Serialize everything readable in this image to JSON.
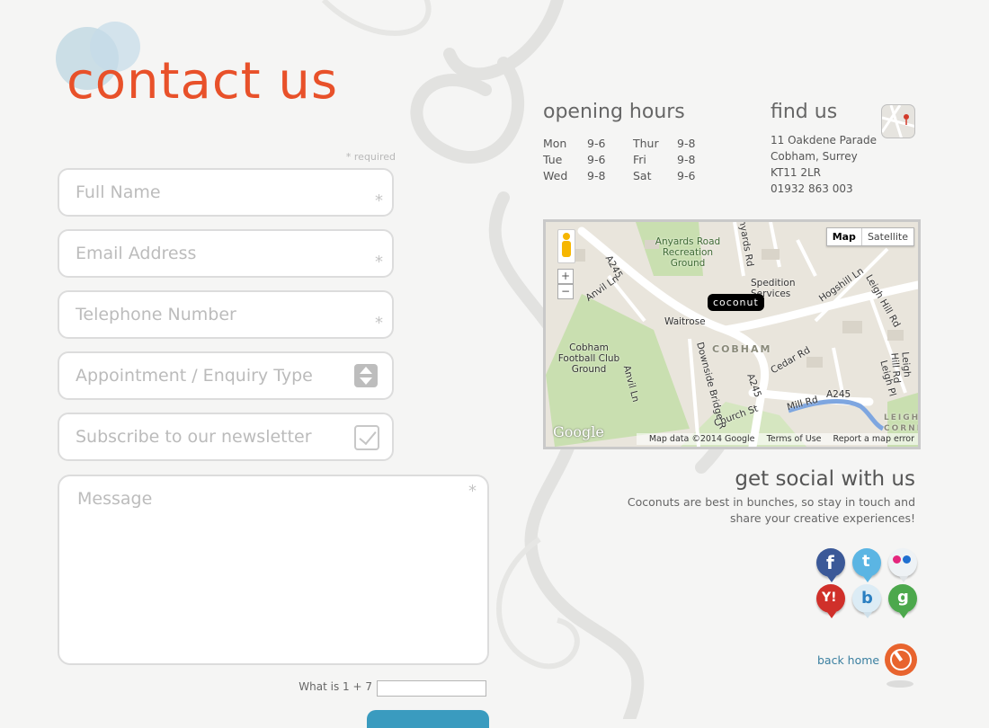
{
  "page": {
    "title": "contact us",
    "required_note": "* required"
  },
  "form": {
    "full_name": {
      "placeholder": "Full Name",
      "required_mark": "*"
    },
    "email": {
      "placeholder": "Email Address",
      "required_mark": "*"
    },
    "telephone": {
      "placeholder": "Telephone Number",
      "required_mark": "*"
    },
    "appointment": {
      "selected": "Appointment / Enquiry Type"
    },
    "newsletter": {
      "label": "Subscribe to our newsletter",
      "checked": true
    },
    "message": {
      "placeholder": "Message",
      "required_mark": "*"
    },
    "captcha": {
      "label": "What is 1 + 7",
      "value": ""
    }
  },
  "opening_hours": {
    "heading": "opening hours",
    "rows": [
      {
        "day1": "Mon",
        "time1": "9-6",
        "day2": "Thur",
        "time2": "9-8"
      },
      {
        "day1": "Tue",
        "time1": "9-6",
        "day2": "Fri",
        "time2": "9-8"
      },
      {
        "day1": "Wed",
        "time1": "9-8",
        "day2": "Sat",
        "time2": "9-6"
      }
    ]
  },
  "find_us": {
    "heading": "find us",
    "address": [
      "11 Oakdene Parade",
      "Cobham, Surrey",
      "KT11 2LR",
      "01932 863 003"
    ],
    "maps_icon": "map-pin-icon"
  },
  "map": {
    "type_map": "Map",
    "type_satellite": "Satellite",
    "zoom_in": "+",
    "zoom_out": "−",
    "marker": "coconut",
    "labels": {
      "recreation": "Anyards Road Recreation Ground",
      "spedition": "Spedition Services",
      "waitrose": "Waitrose",
      "football": "Cobham Football Club Ground",
      "cobham": "COBHAM",
      "a245a": "A245",
      "a245b": "A245",
      "a245c": "A245",
      "anvil": "Anvil Ln",
      "anvil2": "Anvil Ln",
      "downside": "Downside Bridge R",
      "cedar": "Cedar Rd",
      "mill": "Mill Rd",
      "church": "Church St",
      "hogshill": "Hogshill Ln",
      "leigh_hill": "Leigh Hill Rd",
      "leigh_hill2": "Leigh Hill Rd",
      "leigh_pl": "Leigh Pl",
      "anyards": "Anyards Rd",
      "leigh_corner": "LEIGH CORNE"
    },
    "google": "Google",
    "footer": {
      "data": "Map data ©2014 Google",
      "terms": "Terms of Use",
      "report": "Report a map error"
    }
  },
  "social": {
    "heading": "get social with us",
    "text_line1": "Coconuts are best in bunches, so stay in touch and",
    "text_line2": "share your creative experiences!",
    "icons": [
      {
        "name": "facebook",
        "glyph": "f",
        "color": "#3b5998"
      },
      {
        "name": "twitter",
        "glyph": "t",
        "color": "#5bb5e3"
      },
      {
        "name": "flickr",
        "glyph": "●●",
        "color": "#eef2f5"
      },
      {
        "name": "yahoo",
        "glyph": "Y!",
        "color": "#d0302a"
      },
      {
        "name": "bing",
        "glyph": "b",
        "color": "#dcecf5"
      },
      {
        "name": "google",
        "glyph": "g",
        "color": "#4ca84c"
      }
    ]
  },
  "back_home": "back home"
}
